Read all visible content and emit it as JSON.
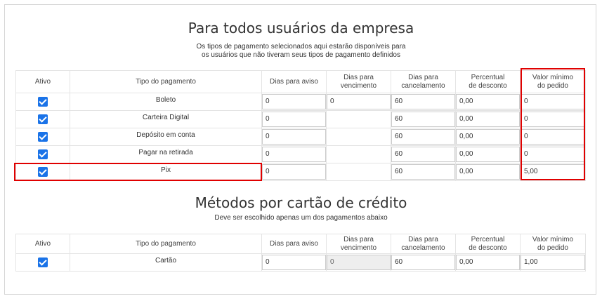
{
  "section1": {
    "title": "Para todos usuários da empresa",
    "description_line1": "Os tipos de pagamento selecionados aqui estarão disponíveis para",
    "description_line2": "os usuários que não tiveram seus tipos de pagamento definidos"
  },
  "columns": {
    "ativo": "Ativo",
    "tipo": "Tipo do pagamento",
    "aviso": "Dias para aviso",
    "vencimento_1": "Dias para",
    "vencimento_2": "vencimento",
    "cancelamento_1": "Dias para",
    "cancelamento_2": "cancelamento",
    "desconto_1": "Percentual",
    "desconto_2": "de desconto",
    "minimo_1": "Valor mínimo",
    "minimo_2": "do pedido"
  },
  "rows": [
    {
      "name": "Boleto",
      "checked": true,
      "aviso": "0",
      "vencimento": "0",
      "cancelamento": "60",
      "desconto": "0,00",
      "minimo": "0"
    },
    {
      "name": "Carteira Digital",
      "checked": true,
      "aviso": "0",
      "vencimento": "",
      "cancelamento": "60",
      "desconto": "0,00",
      "minimo": "0"
    },
    {
      "name": "Depósito em conta",
      "checked": true,
      "aviso": "0",
      "vencimento": "",
      "cancelamento": "60",
      "desconto": "0,00",
      "minimo": "0"
    },
    {
      "name": "Pagar na retirada",
      "checked": true,
      "aviso": "0",
      "vencimento": "",
      "cancelamento": "60",
      "desconto": "0,00",
      "minimo": "0"
    },
    {
      "name": "Pix",
      "checked": true,
      "aviso": "0",
      "vencimento": "",
      "cancelamento": "60",
      "desconto": "0,00",
      "minimo": "5,00"
    }
  ],
  "section2": {
    "title": "Métodos por cartão de crédito",
    "description": "Deve ser escolhido apenas um dos pagamentos abaixo"
  },
  "card_rows": [
    {
      "name": "Cartão",
      "checked": true,
      "aviso": "0",
      "vencimento": "0",
      "cancelamento": "60",
      "desconto": "0,00",
      "minimo": "1,00"
    }
  ],
  "colors": {
    "checkbox": "#1a73e8",
    "highlight": "#e00000",
    "border": "#e4e4e4"
  }
}
